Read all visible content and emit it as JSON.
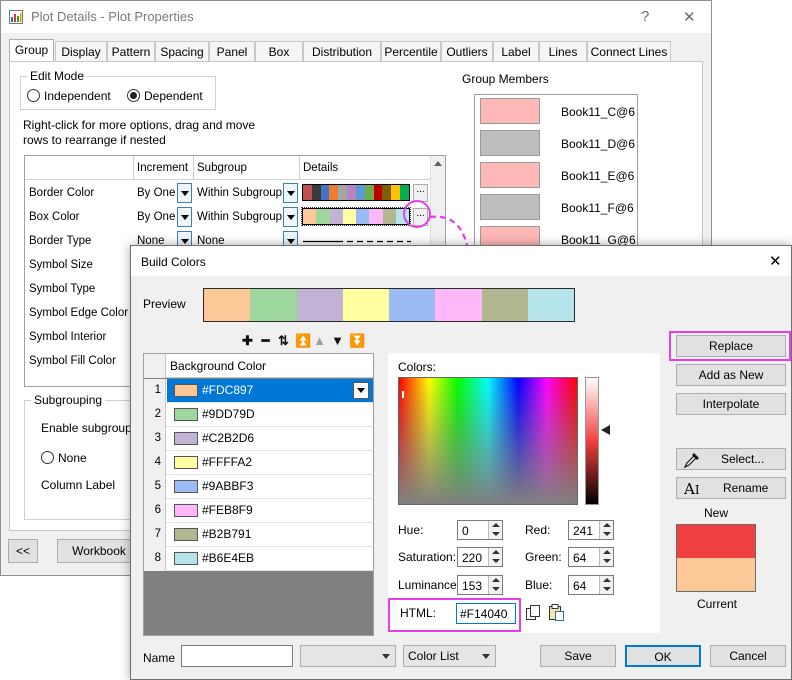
{
  "plot_details": {
    "title": "Plot Details - Plot Properties",
    "help_button": "?",
    "close_button": "✕",
    "tabs": [
      "Group",
      "Display",
      "Pattern",
      "Spacing",
      "Panel",
      "Box",
      "Distribution",
      "Percentile",
      "Outliers",
      "Label",
      "Lines",
      "Connect Lines"
    ],
    "active_tab": "Group",
    "edit_mode": {
      "label": "Edit Mode",
      "options": [
        "Independent",
        "Dependent"
      ],
      "selected": "Dependent"
    },
    "hint": [
      "Right-click for more options, drag and move",
      "rows to  rearrange if nested"
    ],
    "grid": {
      "headers": [
        "Increment",
        "Subgroup",
        "Details"
      ],
      "rows": [
        {
          "name": "Border Color",
          "increment": "By One",
          "subgroup": "Within Subgroup",
          "details": "palette-dark"
        },
        {
          "name": "Box Color",
          "increment": "By One",
          "subgroup": "Within Subgroup",
          "details": "palette-pastel"
        },
        {
          "name": "Border Type",
          "increment": "None",
          "subgroup": "None",
          "details": "line-styles"
        },
        {
          "name": "Symbol Size",
          "increment": "",
          "subgroup": "",
          "details": ""
        },
        {
          "name": "Symbol Type",
          "increment": "",
          "subgroup": "",
          "details": ""
        },
        {
          "name": "Symbol Edge Color",
          "increment": "",
          "subgroup": "",
          "details": ""
        },
        {
          "name": "Symbol Interior",
          "increment": "",
          "subgroup": "",
          "details": ""
        },
        {
          "name": "Symbol Fill Color",
          "increment": "",
          "subgroup": "",
          "details": ""
        }
      ],
      "border_palette": [
        "#c0504d",
        "#3a3a3a",
        "#4472c4",
        "#ed7d31",
        "#a5a5a5",
        "#b486c6",
        "#5b9bd5",
        "#70ad47",
        "#c00000",
        "#7f6000",
        "#ffc000",
        "#00b050"
      ],
      "box_palette": [
        "#FDC897",
        "#9DD79D",
        "#C2B2D6",
        "#FFFFA2",
        "#9ABBF3",
        "#FEB8F9",
        "#B2B791",
        "#B6E4EB"
      ],
      "ellipsis": "..."
    },
    "group_members": {
      "label": "Group Members",
      "items": [
        {
          "name": "Book11_C@6",
          "color": "#FFB8B8"
        },
        {
          "name": "Book11_D@6",
          "color": "#BEBEBE"
        },
        {
          "name": "Book11_E@6",
          "color": "#FFB8B8"
        },
        {
          "name": "Book11_F@6",
          "color": "#BEBEBE"
        },
        {
          "name": "Book11_G@6",
          "color": "#FFB8B8"
        }
      ]
    },
    "subgrouping": {
      "label": "Subgrouping",
      "enable_label": "Enable subgroup",
      "none_label": "None",
      "column_label": "Column Label"
    },
    "buttons": {
      "prev": "<<",
      "workbook": "Workbook"
    }
  },
  "build_colors": {
    "title": "Build Colors",
    "close": "✕",
    "preview_label": "Preview",
    "preview_colors": [
      "#FDC897",
      "#9DD79D",
      "#C2B2D6",
      "#FFFFA2",
      "#9ABBF3",
      "#FEB8F9",
      "#B2B791",
      "#B6E4EB"
    ],
    "toolbar_icons": [
      "plus-icon",
      "minus-icon",
      "swap-icon",
      "move-top-icon",
      "move-up-icon",
      "move-down-icon",
      "move-bottom-icon"
    ],
    "toolbar_glyphs": [
      "✚",
      "━",
      "⇅",
      "⏫",
      "▲",
      "▼",
      "⏬"
    ],
    "list_header": "Background Color",
    "colors": [
      {
        "n": "1",
        "hex": "#FDC897"
      },
      {
        "n": "2",
        "hex": "#9DD79D"
      },
      {
        "n": "3",
        "hex": "#C2B2D6"
      },
      {
        "n": "4",
        "hex": "#FFFFA2"
      },
      {
        "n": "5",
        "hex": "#9ABBF3"
      },
      {
        "n": "6",
        "hex": "#FEB8F9"
      },
      {
        "n": "7",
        "hex": "#B2B791"
      },
      {
        "n": "8",
        "hex": "#B6E4EB"
      }
    ],
    "selected_index": 0,
    "picker": {
      "colors_label": "Colors:",
      "hue": {
        "label": "Hue:",
        "value": "0"
      },
      "saturation": {
        "label": "Saturation:",
        "value": "220"
      },
      "luminance": {
        "label": "Luminance:",
        "value": "153"
      },
      "red": {
        "label": "Red:",
        "value": "241"
      },
      "green": {
        "label": "Green:",
        "value": "64"
      },
      "blue": {
        "label": "Blue:",
        "value": "64"
      },
      "html": {
        "label": "HTML:",
        "value": "#F14040"
      }
    },
    "right_buttons": {
      "replace": "Replace",
      "add_as_new": "Add as New",
      "interpolate": "Interpolate",
      "select": "Select...",
      "rename": "Rename"
    },
    "new_label": "New",
    "current_label": "Current",
    "new_color": "#F14040",
    "current_color": "#FDC897",
    "bottom": {
      "name_label": "Name",
      "name_value": "",
      "combo1_value": "",
      "color_list": "Color List",
      "save": "Save",
      "ok": "OK",
      "cancel": "Cancel"
    },
    "highlight_color": "#E83EE8"
  }
}
